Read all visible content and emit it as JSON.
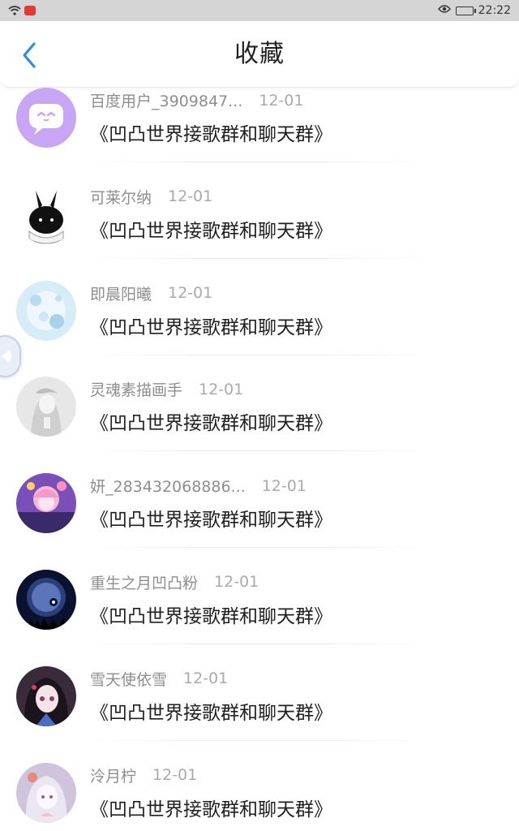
{
  "status_bar": {
    "time": "22:22"
  },
  "header": {
    "title": "收藏"
  },
  "favorites": [
    {
      "user": "百度用户_3909847...",
      "date": "12-01",
      "title": "《凹凸世界接歌群和聊天群》"
    },
    {
      "user": "可莱尔纳",
      "date": "12-01",
      "title": "《凹凸世界接歌群和聊天群》"
    },
    {
      "user": "即晨阳曦",
      "date": "12-01",
      "title": "《凹凸世界接歌群和聊天群》"
    },
    {
      "user": "灵魂素描画手",
      "date": "12-01",
      "title": "《凹凸世界接歌群和聊天群》"
    },
    {
      "user": "妍_283432068886...",
      "date": "12-01",
      "title": "《凹凸世界接歌群和聊天群》"
    },
    {
      "user": "重生之月凹凸粉",
      "date": "12-01",
      "title": "《凹凸世界接歌群和聊天群》"
    },
    {
      "user": "雪天使依雪",
      "date": "12-01",
      "title": "《凹凸世界接歌群和聊天群》"
    },
    {
      "user": "泠月柠",
      "date": "12-01",
      "title": "《凹凸世界接歌群和聊天群》"
    }
  ],
  "colors": {
    "accent": "#2f8de4",
    "avatar_default": "#c9a6f5"
  }
}
